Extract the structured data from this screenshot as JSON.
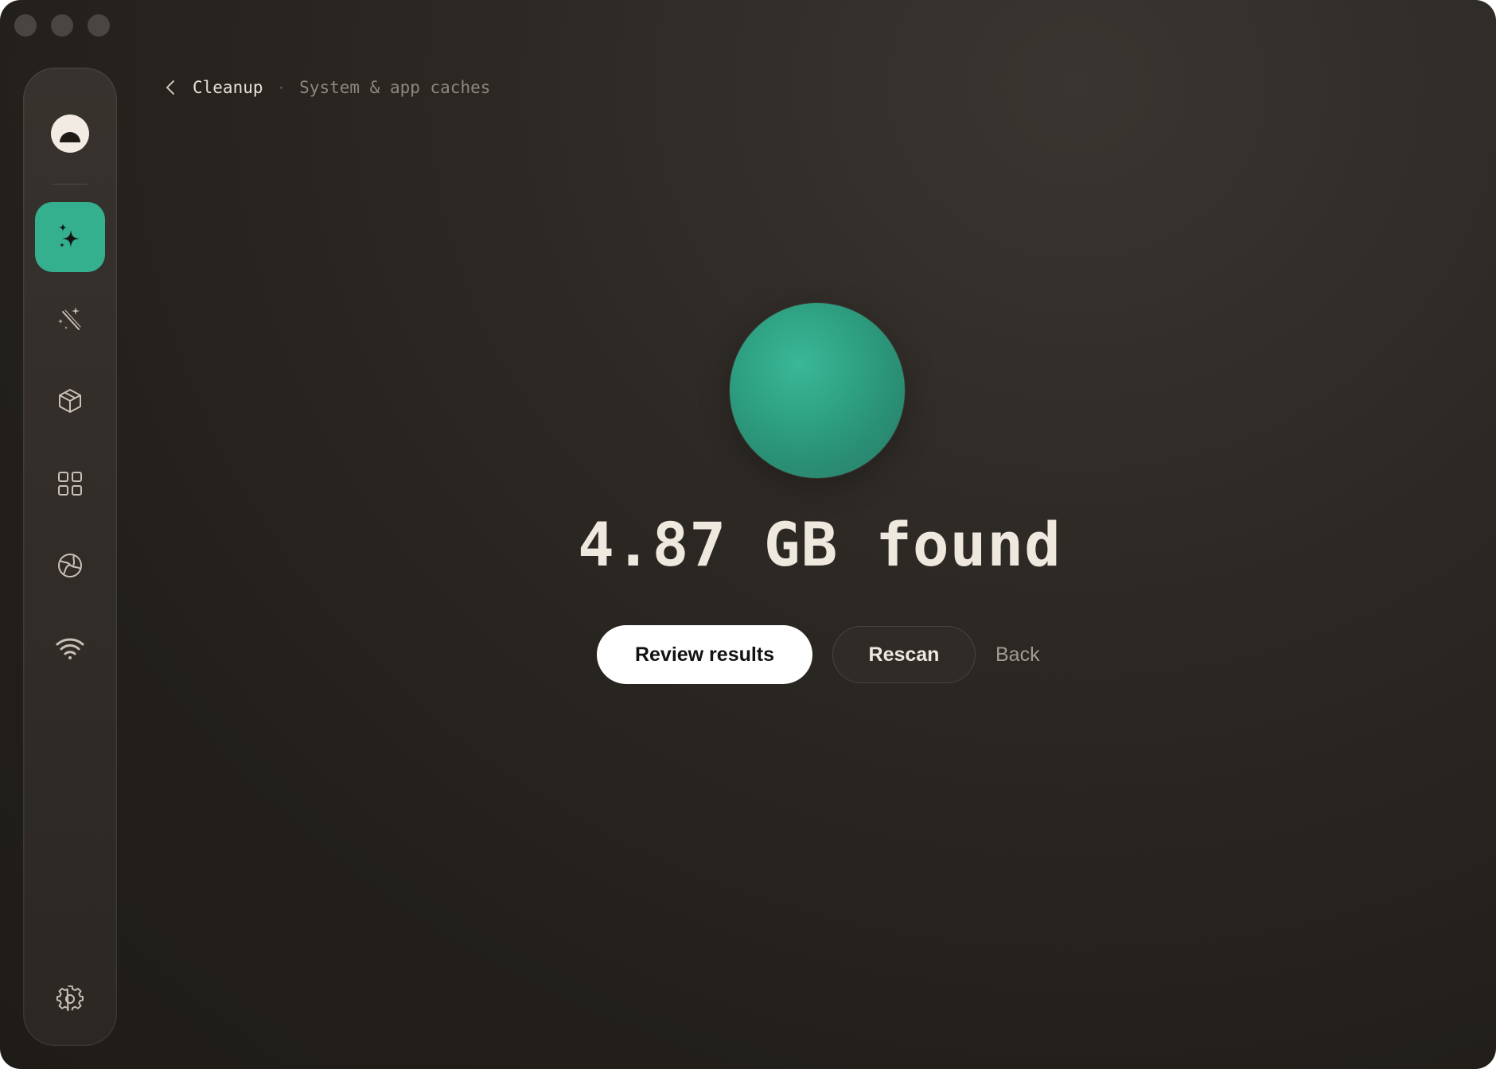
{
  "window": {
    "traffic_lights": [
      "close",
      "minimize",
      "zoom"
    ]
  },
  "sidebar": {
    "logo": "app-logo",
    "items": [
      {
        "id": "smart-scan",
        "icon": "sparkles-icon",
        "active": true
      },
      {
        "id": "cleanup",
        "icon": "magic-wand-icon",
        "active": false
      },
      {
        "id": "applications",
        "icon": "package-icon",
        "active": false
      },
      {
        "id": "widgets",
        "icon": "grid-icon",
        "active": false
      },
      {
        "id": "internet",
        "icon": "globe-icon",
        "active": false
      },
      {
        "id": "network",
        "icon": "wifi-icon",
        "active": false
      }
    ],
    "settings": {
      "icon": "gear-icon"
    }
  },
  "breadcrumb": {
    "current": "Cleanup",
    "separator": "·",
    "sub": "System & app caches"
  },
  "result": {
    "text": "4.87 GB found"
  },
  "actions": {
    "primary_label": "Review results",
    "secondary_label": "Rescan",
    "link_label": "Back"
  },
  "colors": {
    "accent": "#34b08f",
    "background": "#221f1b",
    "text": "#efe8df"
  }
}
